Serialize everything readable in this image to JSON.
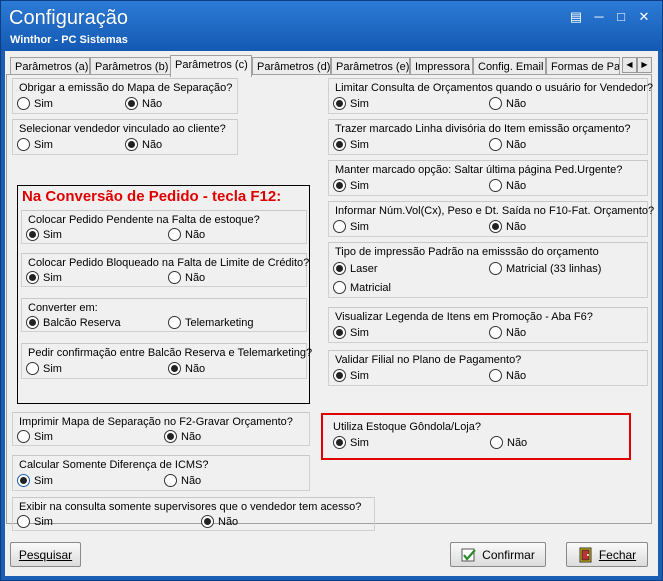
{
  "window": {
    "title": "Configuração",
    "subtitle": "Winthor - PC Sistemas"
  },
  "tabs": [
    {
      "label": "Parâmetros (a)"
    },
    {
      "label": "Parâmetros (b)"
    },
    {
      "label": "Parâmetros (c)",
      "active": true
    },
    {
      "label": "Parâmetros (d)"
    },
    {
      "label": "Parâmetros (e)"
    },
    {
      "label": "Impressora"
    },
    {
      "label": "Config. Email"
    },
    {
      "label": "Formas de Pa"
    }
  ],
  "options": {
    "sim": "Sim",
    "nao": "Não"
  },
  "left": {
    "obrigar_mapa": {
      "question": "Obrigar a emissão do Mapa de Separação?",
      "selected": "Não"
    },
    "selecionar_vendedor": {
      "question": "Selecionar vendedor vinculado ao cliente?",
      "selected": "Não"
    },
    "conversao_title": "Na Conversão de Pedido - tecla F12:",
    "pedido_pendente": {
      "question": "Colocar Pedido Pendente na Falta de estoque?",
      "selected": "Sim"
    },
    "pedido_bloqueado": {
      "question": "Colocar Pedido Bloqueado na Falta de Limite de Crédito?",
      "selected": "Sim"
    },
    "converter_em": {
      "question": "Converter em:",
      "opt1": "Balcão Reserva",
      "opt2": "Telemarketing",
      "selected": "Balcão Reserva"
    },
    "pedir_confirmacao": {
      "question": "Pedir confirmação entre Balcão Reserva e Telemarketing?",
      "selected": "Não"
    },
    "imprimir_mapa": {
      "question": "Imprimir Mapa de Separação no F2-Gravar Orçamento?",
      "selected": "Não"
    },
    "calcular_icms": {
      "question": "Calcular Somente Diferença de ICMS?",
      "selected": "Sim"
    },
    "exibir_supervisores": {
      "question": "Exibir na consulta somente supervisores que o vendedor tem acesso?",
      "selected": "Não"
    }
  },
  "right": {
    "limitar_consulta": {
      "question": "Limitar Consulta de Orçamentos quando o usuário for Vendedor?",
      "selected": "Sim"
    },
    "trazer_linha": {
      "question": "Trazer marcado Linha divisória do Item emissão orçamento?",
      "selected": "Sim"
    },
    "manter_marcado": {
      "question": "Manter marcado opção: Saltar última página Ped.Urgente?",
      "selected": "Sim"
    },
    "informar_num": {
      "question": "Informar Núm.Vol(Cx), Peso e Dt. Saída no F10-Fat. Orçamento?",
      "selected": "Não"
    },
    "tipo_impressao": {
      "question": "Tipo de impressão Padrão na emisssão do orçamento",
      "opt1": "Laser",
      "opt2": "Matricial (33 linhas)",
      "opt3": "Matricial",
      "selected": "Laser"
    },
    "visualizar_legenda": {
      "question": "Visualizar Legenda de Itens em Promoção - Aba F6?",
      "selected": "Sim"
    },
    "validar_filial": {
      "question": "Validar Filial no Plano de Pagamento?",
      "selected": "Sim"
    },
    "estoque_gondola": {
      "question": "Utiliza Estoque Gôndola/Loja?",
      "selected": "Sim"
    }
  },
  "buttons": {
    "pesquisar": "Pesquisar",
    "confirmar": "Confirmar",
    "fechar": "Fechar"
  },
  "colors": {
    "titlebar": "#1a5fb4",
    "highlight": "#e00000"
  }
}
